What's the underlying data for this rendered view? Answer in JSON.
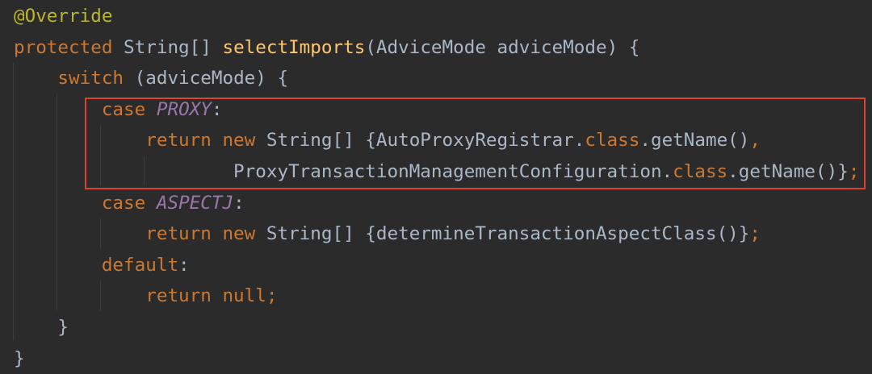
{
  "colors": {
    "background": "#2b2b2b",
    "keyword": "#cc7832",
    "annotation": "#bbb529",
    "function": "#ffc66d",
    "constant": "#9876aa",
    "text": "#a9b7c6",
    "highlight_box": "#e0432c"
  },
  "code": {
    "lines": [
      [
        {
          "t": "@Override",
          "k": "ann"
        }
      ],
      [
        {
          "t": "protected",
          "k": "kw"
        },
        {
          "t": " String[] ",
          "k": "id"
        },
        {
          "t": "selectImports",
          "k": "fn"
        },
        {
          "t": "(AdviceMode adviceMode) {",
          "k": "id"
        }
      ],
      [
        {
          "t": "    ",
          "k": "id"
        },
        {
          "t": "switch",
          "k": "kw"
        },
        {
          "t": " (adviceMode) {",
          "k": "id"
        }
      ],
      [
        {
          "t": "        ",
          "k": "id"
        },
        {
          "t": "case",
          "k": "kw"
        },
        {
          "t": " ",
          "k": "id"
        },
        {
          "t": "PROXY",
          "k": "const"
        },
        {
          "t": ":",
          "k": "id"
        }
      ],
      [
        {
          "t": "            ",
          "k": "id"
        },
        {
          "t": "return new",
          "k": "kw"
        },
        {
          "t": " String[] {AutoProxyRegistrar.",
          "k": "id"
        },
        {
          "t": "class",
          "k": "kw"
        },
        {
          "t": ".getName()",
          "k": "id"
        },
        {
          "t": ",",
          "k": "kw"
        }
      ],
      [
        {
          "t": "                    ProxyTransactionManagementConfiguration.",
          "k": "id"
        },
        {
          "t": "class",
          "k": "kw"
        },
        {
          "t": ".getName()}",
          "k": "id"
        },
        {
          "t": ";",
          "k": "kw"
        }
      ],
      [
        {
          "t": "        ",
          "k": "id"
        },
        {
          "t": "case",
          "k": "kw"
        },
        {
          "t": " ",
          "k": "id"
        },
        {
          "t": "ASPECTJ",
          "k": "const"
        },
        {
          "t": ":",
          "k": "id"
        }
      ],
      [
        {
          "t": "            ",
          "k": "id"
        },
        {
          "t": "return new",
          "k": "kw"
        },
        {
          "t": " String[] {determineTransactionAspectClass()}",
          "k": "id"
        },
        {
          "t": ";",
          "k": "kw"
        }
      ],
      [
        {
          "t": "        ",
          "k": "id"
        },
        {
          "t": "default",
          "k": "kw"
        },
        {
          "t": ":",
          "k": "id"
        }
      ],
      [
        {
          "t": "            ",
          "k": "id"
        },
        {
          "t": "return null;",
          "k": "kw"
        }
      ],
      [
        {
          "t": "    }",
          "k": "id"
        }
      ],
      [
        {
          "t": "}",
          "k": "id"
        }
      ]
    ]
  }
}
